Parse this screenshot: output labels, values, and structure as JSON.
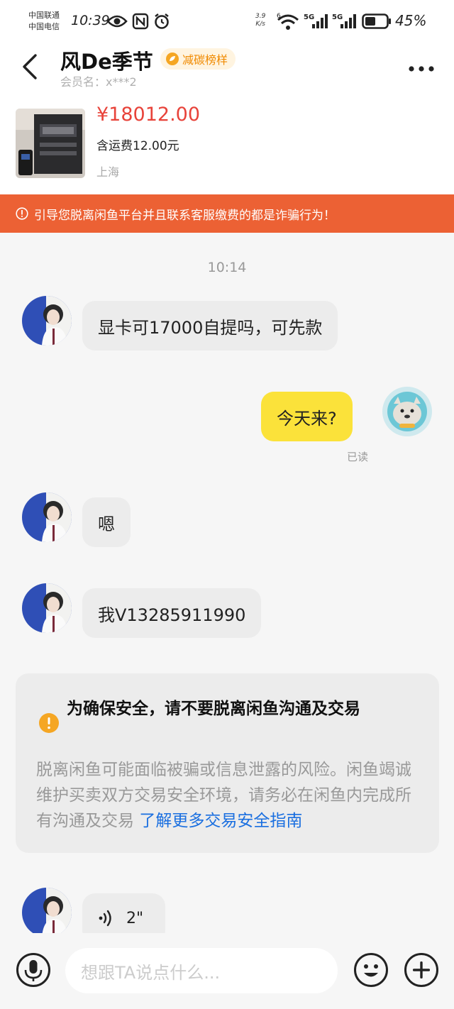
{
  "status_bar": {
    "carrier_1": "中国联通",
    "carrier_2": "中国电信",
    "time": "10:39",
    "net_speed_value": "3.9",
    "net_speed_unit": "K/s",
    "signal_1_label": "5G",
    "signal_2_label": "5G",
    "wifi_label": "6",
    "battery_percent": "45%"
  },
  "header": {
    "title": "风De季节",
    "badge_label": "减碳榜样",
    "member_label": "会员名：x***2"
  },
  "product": {
    "price": "¥18012.00",
    "shipping": "含运费12.00元",
    "location": "上海"
  },
  "warning": {
    "text": "引导您脱离闲鱼平台并且联系客服缴费的都是诈骗行为！"
  },
  "chat": {
    "timestamp": "10:14",
    "messages": [
      {
        "side": "in",
        "text": "显卡可17000自提吗，可先款"
      },
      {
        "side": "out",
        "text": "今天来?",
        "status": "已读"
      },
      {
        "side": "in",
        "text": "嗯"
      },
      {
        "side": "in",
        "text": "我V13285911990"
      }
    ],
    "voice_message": {
      "duration": "2\""
    }
  },
  "safety_card": {
    "title": "为确保安全，请不要脱离闲鱼沟通及交易",
    "body": "脱离闲鱼可能面临被骗或信息泄露的风险。闲鱼竭诚维护买卖双方交易安全环境，请务必在闲鱼内完成所有沟通及交易",
    "link": "了解更多交易安全指南"
  },
  "input_bar": {
    "placeholder": "想跟TA说点什么..."
  },
  "icons": {
    "back": "chevron-left-icon",
    "more": "more-dots-icon",
    "warning": "alert-circle-icon",
    "safety": "exclamation-icon",
    "voice_input": "microphone-icon",
    "emoji": "smile-icon",
    "add": "plus-circle-icon",
    "voice_wave": "sound-wave-icon"
  },
  "colors": {
    "accent_price": "#e8433a",
    "warning_bar": "#ec6134",
    "bubble_out": "#fbe23a",
    "link": "#1a6fe0",
    "badge": "#f08a00"
  }
}
